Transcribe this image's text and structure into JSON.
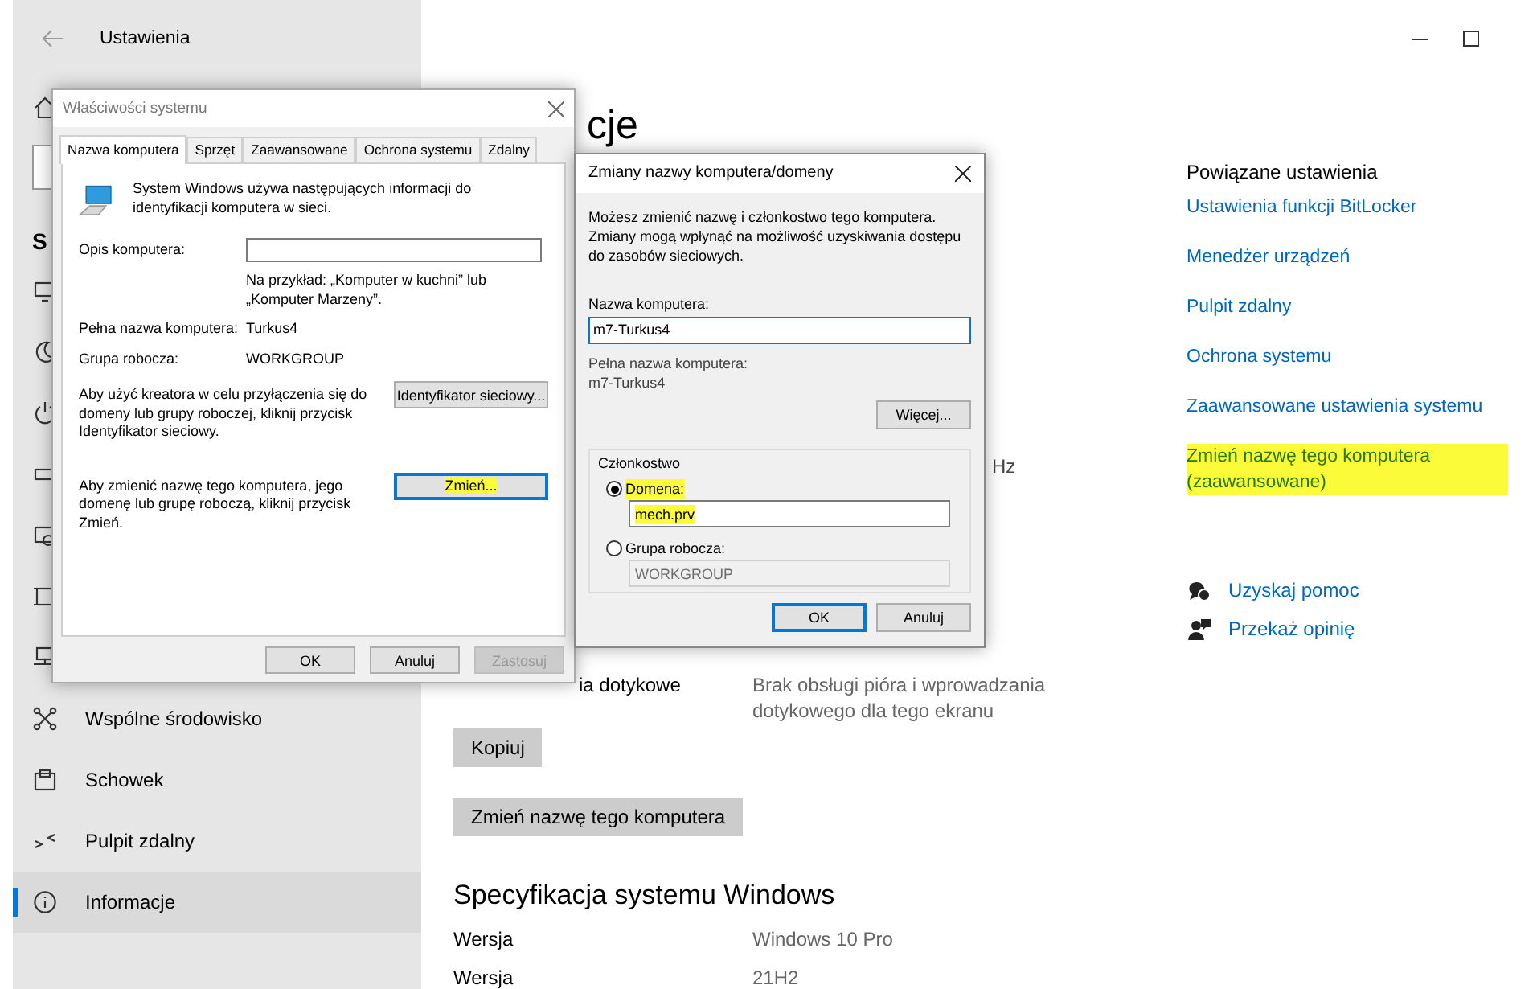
{
  "settings": {
    "title": "Ustawienia",
    "sidebar": {
      "header": "S",
      "items": [
        {
          "kind": "icon",
          "selected": false
        },
        {
          "kind": "search"
        },
        {
          "kind": "header"
        },
        {
          "kind": "icon",
          "selected": false
        },
        {
          "kind": "icon",
          "selected": false
        },
        {
          "kind": "icon",
          "selected": false
        },
        {
          "kind": "icon",
          "selected": false
        },
        {
          "kind": "icon",
          "selected": false
        },
        {
          "kind": "icon",
          "selected": false
        },
        {
          "kind": "icon",
          "selected": false
        },
        {
          "kind": "item",
          "label": "Wspólne środowisko",
          "selected": false
        },
        {
          "kind": "item",
          "label": "Schowek",
          "selected": false
        },
        {
          "kind": "item",
          "label": "Pulpit zdalny",
          "selected": false
        },
        {
          "kind": "item",
          "label": "Informacje",
          "selected": true
        }
      ]
    },
    "main": {
      "heading_fragment": "cje",
      "processor_fragment": "Hz",
      "pen_row": {
        "label": "ia dotykowe",
        "value": "Brak obsługi pióra i wprowadzania dotykowego dla tego ekranu"
      },
      "buttons": [
        "Kopiuj",
        "Zmień nazwę tego komputera"
      ],
      "spec_heading": "Specyfikacja systemu Windows",
      "spec_rows": [
        {
          "label": "Wersja",
          "value": "Windows 10 Pro"
        },
        {
          "label": "Wersja",
          "value": "21H2"
        }
      ]
    },
    "related": {
      "title": "Powiązane ustawienia",
      "links": [
        {
          "text": "Ustawienia funkcji BitLocker",
          "highlighted": false
        },
        {
          "text": "Menedżer urządzeń",
          "highlighted": false
        },
        {
          "text": "Pulpit zdalny",
          "highlighted": false
        },
        {
          "text": "Ochrona systemu",
          "highlighted": false
        },
        {
          "text": "Zaawansowane ustawienia systemu",
          "highlighted": false
        },
        {
          "text": "Zmień nazwę tego komputera (zaawansowane)",
          "highlighted": true
        }
      ],
      "help": [
        "Uzyskaj pomoc",
        "Przekaż opinię"
      ]
    }
  },
  "system_properties": {
    "title": "Właściwości systemu",
    "tabs": [
      {
        "label": "Nazwa komputera",
        "selected": true
      },
      {
        "label": "Sprzęt",
        "selected": false
      },
      {
        "label": "Zaawansowane",
        "selected": false
      },
      {
        "label": "Ochrona systemu",
        "selected": false
      },
      {
        "label": "Zdalny",
        "selected": false
      }
    ],
    "intro": "System Windows używa następujących informacji do identyfikacji komputera w sieci.",
    "description_label": "Opis komputera:",
    "example": "Na przykład: „Komputer w kuchni” lub „Komputer Marzeny”.",
    "full_name_label": "Pełna nazwa komputera:",
    "full_name": "Turkus4",
    "workgroup_label": "Grupa robocza:",
    "workgroup": "WORKGROUP",
    "actions": [
      {
        "text": "Aby użyć kreatora w celu przyłączenia się do domeny lub grupy roboczej, kliknij przycisk Identyfikator sieciowy.",
        "button": "Identyfikator sieciowy...",
        "focused": false,
        "highlighted": false
      },
      {
        "text": "Aby zmienić nazwę tego komputera, jego domenę lub grupę roboczą, kliknij przycisk Zmień.",
        "button": "Zmień...",
        "focused": true,
        "highlighted": true
      }
    ],
    "buttons": [
      {
        "label": "OK",
        "disabled": false
      },
      {
        "label": "Anuluj",
        "disabled": false
      },
      {
        "label": "Zastosuj",
        "disabled": true
      }
    ]
  },
  "rename_dialog": {
    "title": "Zmiany nazwy komputera/domeny",
    "intro": "Możesz zmienić nazwę i członkostwo tego komputera. Zmiany mogą wpłynąć na możliwość uzyskiwania dostępu do zasobów sieciowych.",
    "name_label": "Nazwa komputera:",
    "name_value": "m7-Turkus4",
    "full_name_label": "Pełna nazwa komputera:",
    "full_name": "m7-Turkus4",
    "more_button": "Więcej...",
    "membership": {
      "title": "Członkostwo",
      "options": [
        {
          "label": "Domena:",
          "selected": true,
          "value": "mech.prv",
          "disabled": false,
          "highlighted": true
        },
        {
          "label": "Grupa robocza:",
          "selected": false,
          "value": "WORKGROUP",
          "disabled": true,
          "highlighted": false
        }
      ]
    },
    "buttons": [
      {
        "label": "OK",
        "focused": true
      },
      {
        "label": "Anuluj",
        "focused": false
      }
    ]
  }
}
